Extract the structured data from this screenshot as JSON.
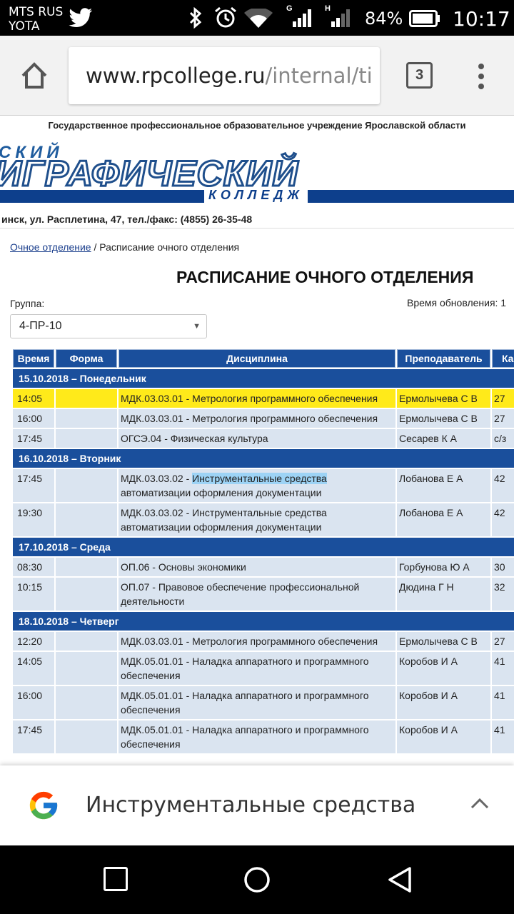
{
  "status_bar": {
    "carrier_line1": "MTS RUS",
    "carrier_line2": "YOTA",
    "battery": "84%",
    "time": "10:17",
    "signal1_label": "G",
    "signal2_label": "H"
  },
  "browser": {
    "url_host": "www.rpcollege.ru",
    "url_path": "/internal/ti",
    "tab_count": "3"
  },
  "site": {
    "org_title": "Государственное профессиональное образовательное учреждение Ярославской области",
    "banner_line1": "СКИЙ",
    "banner_line2": "ИГРАФИЧЕСКИЙ",
    "banner_line3": "КОЛЛЕДЖ",
    "address": "инск, ул. Расплетина, 47, тел./факс: (4855) 26-35-48"
  },
  "page": {
    "breadcrumb_link": "Очное отделение",
    "breadcrumb_sep": " / ",
    "breadcrumb_current": "Расписание очного отделения",
    "title": "РАСПИСАНИЕ ОЧНОГО ОТДЕЛЕНИЯ",
    "group_label": "Группа:",
    "update_label": "Время обновления: 1",
    "group_value": "4-ПР-10"
  },
  "table": {
    "headers": [
      "Время",
      "Форма",
      "Дисциплина",
      "Преподаватель",
      "Каб."
    ],
    "rows": [
      {
        "day": "15.10.2018 – Понедельник"
      },
      {
        "time": "14:05",
        "form": "",
        "subject": "МДК.03.03.01 - Метрология программного обеспечения",
        "teacher": "Ермолычева С В",
        "room": "27",
        "current": true
      },
      {
        "time": "16:00",
        "form": "",
        "subject": "МДК.03.03.01 - Метрология программного обеспечения",
        "teacher": "Ермолычева С В",
        "room": "27"
      },
      {
        "time": "17:45",
        "form": "",
        "subject": "ОГСЭ.04 - Физическая культура",
        "teacher": "Сесарев К А",
        "room": "с/з"
      },
      {
        "day": "16.10.2018 – Вторник"
      },
      {
        "time": "17:45",
        "form": "",
        "subject_pre": "МДК.03.03.02 - ",
        "subject_hl": "Инструментальные средства",
        "subject_post": " автоматизации оформления документации",
        "teacher": "Лобанова Е А",
        "room": "42"
      },
      {
        "time": "19:30",
        "form": "",
        "subject": "МДК.03.03.02 - Инструментальные средства автоматизации оформления документации",
        "teacher": "Лобанова Е А",
        "room": "42"
      },
      {
        "day": "17.10.2018 – Среда"
      },
      {
        "time": "08:30",
        "form": "",
        "subject": "ОП.06 - Основы экономики",
        "teacher": "Горбунова Ю А",
        "room": "30"
      },
      {
        "time": "10:15",
        "form": "",
        "subject": "ОП.07 - Правовое обеспечение профессиональной деятельности",
        "teacher": "Дюдина Г Н",
        "room": "32"
      },
      {
        "day": "18.10.2018 – Четверг"
      },
      {
        "time": "12:20",
        "form": "",
        "subject": "МДК.03.03.01 - Метрология программного обеспечения",
        "teacher": "Ермолычева С В",
        "room": "27"
      },
      {
        "time": "14:05",
        "form": "",
        "subject": "МДК.05.01.01 - Наладка аппаратного и программного обеспечения",
        "teacher": "Коробов И А",
        "room": "41"
      },
      {
        "time": "16:00",
        "form": "",
        "subject": "МДК.05.01.01 - Наладка аппаратного и программного обеспечения",
        "teacher": "Коробов И А",
        "room": "41"
      },
      {
        "time": "17:45",
        "form": "",
        "subject": "МДК.05.01.01 - Наладка аппаратного и программного обеспечения",
        "teacher": "Коробов И А",
        "room": "41"
      }
    ]
  },
  "find_bar": {
    "query": "Инструментальные средства"
  },
  "icons": {
    "twitter": "twitter-icon",
    "bluetooth": "bluetooth-icon",
    "alarm": "alarm-icon",
    "wifi": "wifi-icon",
    "home": "home-icon",
    "google": "google-icon"
  }
}
